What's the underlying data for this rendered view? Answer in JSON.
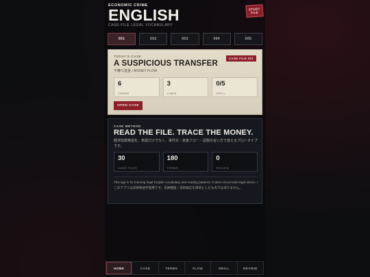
{
  "header": {
    "kicker": "ECONOMIC CRIME",
    "title": "ENGLISH",
    "subtitle": "CASE-FILE LEGAL VOCABULARY",
    "study_line1": "STUDY",
    "study_line2": "FILE"
  },
  "tabs": [
    {
      "label": "001",
      "active": true
    },
    {
      "label": "002",
      "active": false
    },
    {
      "label": "003",
      "active": false
    },
    {
      "label": "004",
      "active": false
    },
    {
      "label": "005",
      "active": false
    }
  ],
  "today_case": {
    "label": "TODAY'S CASE",
    "title": "A SUSPICIOUS TRANSFER",
    "subtitle": "不審な送金 / MONEY FLOW",
    "badge": "CASE FILE 001",
    "stats": [
      {
        "value": "6",
        "label": "TERMS"
      },
      {
        "value": "3",
        "label": "LINES"
      },
      {
        "value": "0/5",
        "label": "DRILL"
      }
    ],
    "open_button": "OPEN CASE"
  },
  "case_method": {
    "label": "CASE METHOD",
    "title": "READ THE FILE. TRACE THE MONEY.",
    "description": "経済犯罪英語を、単語だけでなく、事件文・資金フロー・証拠の言い方で覚えるプロトタイプです。",
    "stats": [
      {
        "value": "30",
        "label": "CASE FILES"
      },
      {
        "value": "180",
        "label": "TERMS"
      },
      {
        "value": "0",
        "label": "REVIEW"
      }
    ],
    "disclaimer": "This app is for learning legal English vocabulary and reading patterns. It does not provide legal advice. / このアプリは法律英語学習用です。法律相談・法的助言を目的としたものではありません。"
  },
  "bottom_nav": [
    {
      "label": "HOME",
      "active": true
    },
    {
      "label": "CASE",
      "active": false
    },
    {
      "label": "TERMS",
      "active": false
    },
    {
      "label": "FLOW",
      "active": false
    },
    {
      "label": "DRILL",
      "active": false
    },
    {
      "label": "REVIEW",
      "active": false
    }
  ],
  "colors": {
    "accent": "#8e1f2a",
    "paper": "#e3dccb",
    "background": "#0d0e11"
  }
}
